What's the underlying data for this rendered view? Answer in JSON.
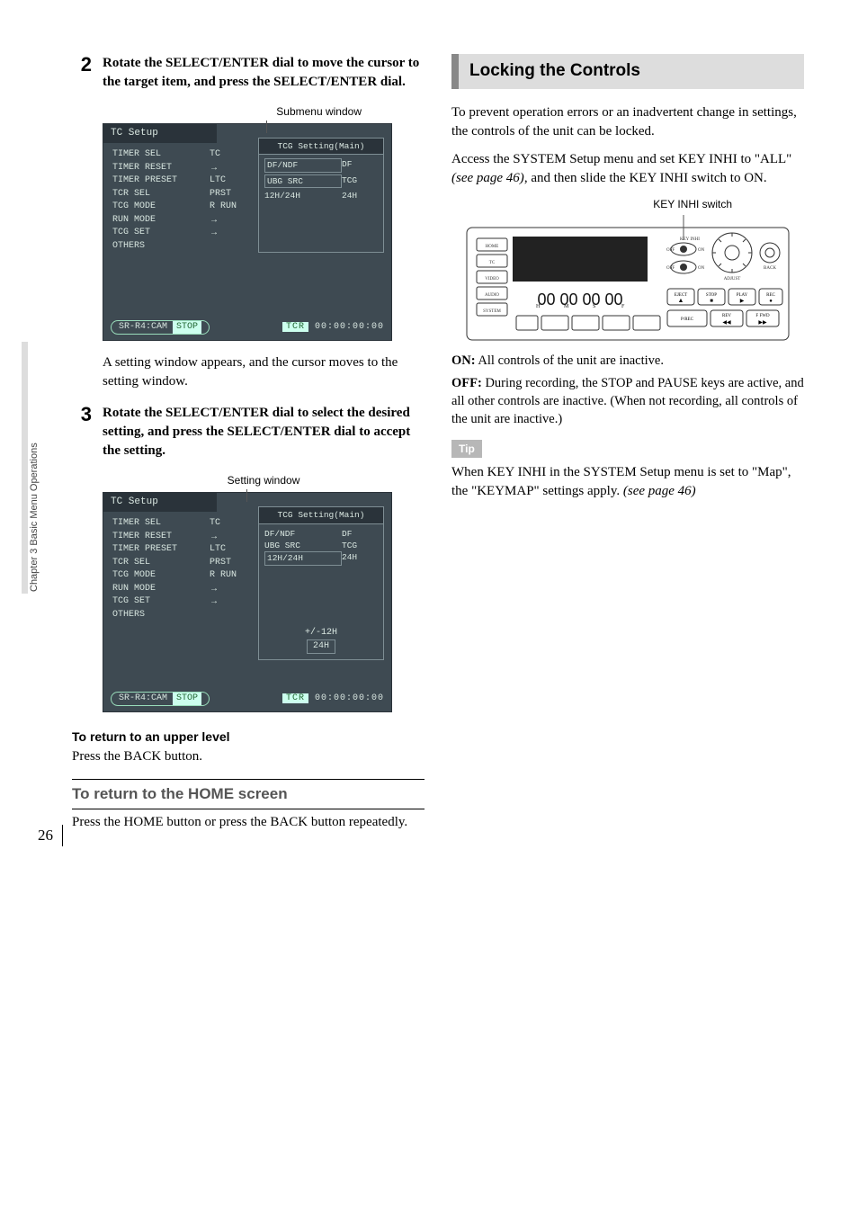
{
  "side_tab": "Chapter 3  Basic Menu Operations",
  "page_number": "26",
  "left": {
    "step2": {
      "num": "2",
      "text": "Rotate the SELECT/ENTER dial to move the cursor to the target item, and press the SELECT/ENTER dial.",
      "caption": "Submenu window",
      "after": "A setting window appears, and the cursor moves to the setting window."
    },
    "step3": {
      "num": "3",
      "text": "Rotate the SELECT/ENTER dial to select the desired setting, and press the SELECT/ENTER dial to accept the setting.",
      "caption": "Setting window"
    },
    "screen": {
      "title": "TC Setup",
      "items": [
        "TIMER SEL",
        "TIMER RESET",
        "TIMER PRESET",
        "TCR SEL",
        "TCG MODE",
        "RUN MODE",
        "TCG SET",
        "OTHERS"
      ],
      "values": [
        "TC",
        "",
        "→",
        "LTC",
        "PRST",
        "R RUN",
        "→",
        "→"
      ],
      "sub_title": "TCG Setting(Main)",
      "sub_rows": [
        {
          "k": "DF/NDF",
          "v": "DF"
        },
        {
          "k": "UBG SRC",
          "v": "TCG"
        },
        {
          "k": "12H/24H",
          "v": "24H"
        }
      ],
      "opts": [
        "+/-12H",
        "24H"
      ],
      "foot_device": "SR-R4:CAM",
      "foot_state": "STOP",
      "foot_tcr": "TCR",
      "foot_time": "00:00:00:00"
    },
    "upper": {
      "heading": "To return to an upper level",
      "text": "Press the BACK button."
    },
    "home": {
      "heading": "To return to the HOME screen",
      "text": "Press the HOME button or press the BACK button repeatedly."
    }
  },
  "right": {
    "section_title": "Locking the Controls",
    "intro": "To prevent operation errors or an inadvertent change in settings, the controls of the unit can be locked.",
    "access_pre": "Access the SYSTEM Setup menu and set KEY INHI to \"ALL\" ",
    "access_ref": "(see page 46)",
    "access_post": ", and then slide the KEY INHI switch to ON.",
    "panel_caption": "KEY INHI switch",
    "on_label": "ON:",
    "on_text": " All controls of the unit are inactive.",
    "off_label": "OFF:",
    "off_text": " During recording, the STOP and PAUSE keys are active, and all other controls are inactive. (When not recording, all controls of the unit are inactive.)",
    "tip_label": "Tip",
    "tip_text_pre": "When KEY INHI in the SYSTEM Setup menu is set to \"Map\", the \"KEYMAP\" settings apply. ",
    "tip_ref": "(see page 46)"
  }
}
